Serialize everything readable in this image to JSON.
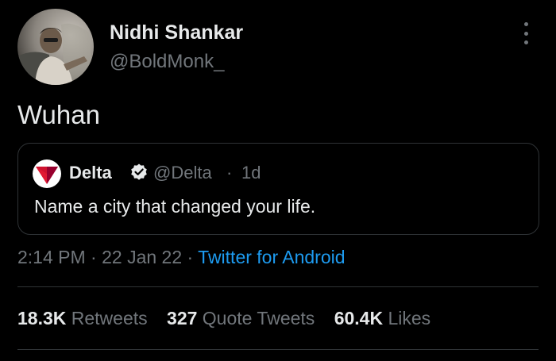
{
  "author": {
    "display_name": "Nidhi Shankar",
    "handle": "@BoldMonk_",
    "avatar_icon": "profile-photo"
  },
  "tweet": {
    "text": "Wuhan"
  },
  "quoted_tweet": {
    "name": "Delta",
    "verified_icon": "verified-badge-icon",
    "handle": "@Delta",
    "separator": "·",
    "time": "1d",
    "text": "Name a city that changed your life.",
    "logo_icon": "delta-logo-icon"
  },
  "meta": {
    "time": "2:14 PM",
    "sep1": " · ",
    "date": "22 Jan 22",
    "sep2": " · ",
    "source": "Twitter for Android"
  },
  "stats": {
    "retweets_count": "18.3K",
    "retweets_label": "Retweets",
    "quotes_count": "327",
    "quotes_label": "Quote Tweets",
    "likes_count": "60.4K",
    "likes_label": "Likes"
  },
  "colors": {
    "background": "#000000",
    "text": "#e7e9ea",
    "muted": "#71767b",
    "link": "#1d9bf0",
    "border": "#2f3336",
    "delta_red": "#e01933",
    "delta_dark_red": "#98002e"
  }
}
